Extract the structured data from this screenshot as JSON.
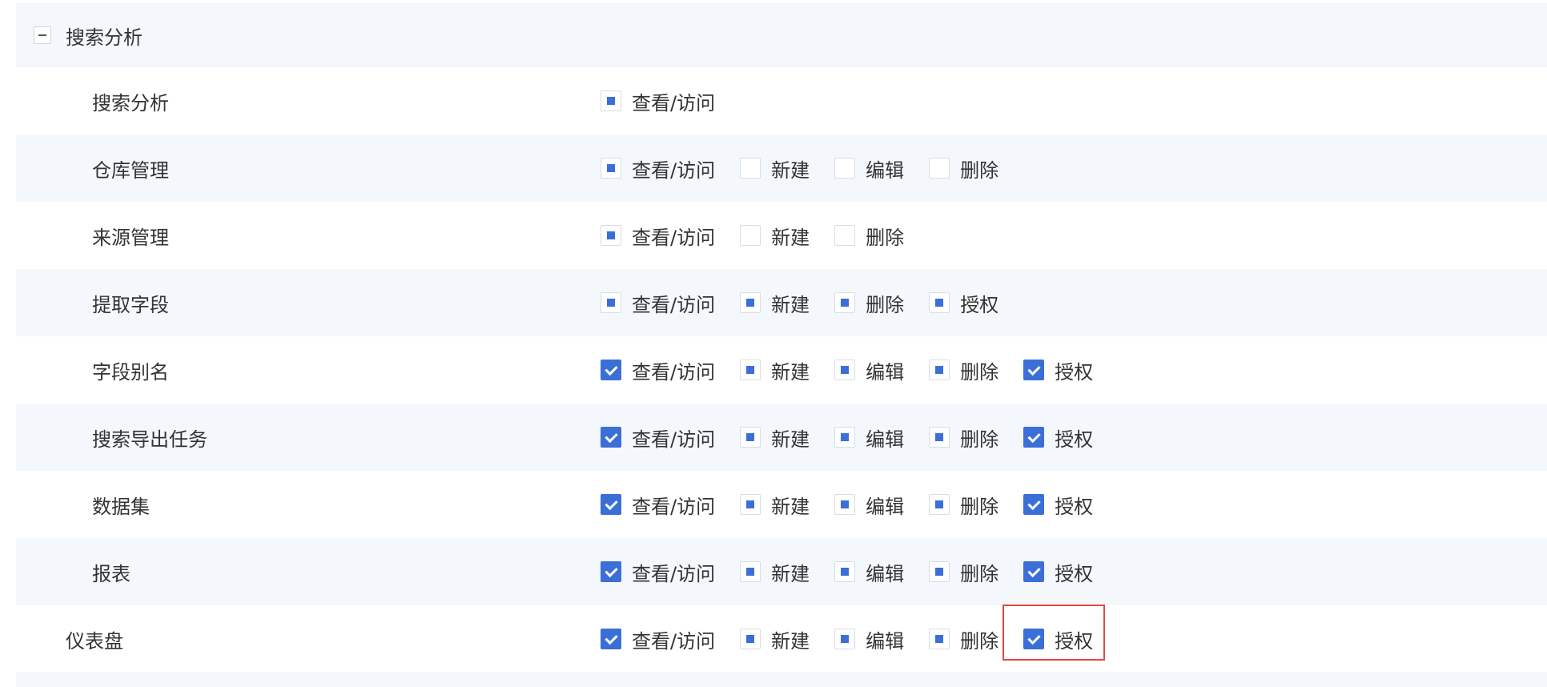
{
  "group": {
    "label": "搜索分析",
    "toggle_icon": "minus-icon"
  },
  "rows": [
    {
      "label": "搜索分析",
      "level": "child",
      "perms": [
        {
          "label": "查看/访问",
          "state": "partial"
        }
      ]
    },
    {
      "label": "仓库管理",
      "level": "child",
      "perms": [
        {
          "label": "查看/访问",
          "state": "partial"
        },
        {
          "label": "新建",
          "state": "unchecked"
        },
        {
          "label": "编辑",
          "state": "unchecked"
        },
        {
          "label": "删除",
          "state": "unchecked"
        }
      ]
    },
    {
      "label": "来源管理",
      "level": "child",
      "perms": [
        {
          "label": "查看/访问",
          "state": "partial"
        },
        {
          "label": "新建",
          "state": "unchecked"
        },
        {
          "label": "删除",
          "state": "unchecked"
        }
      ]
    },
    {
      "label": "提取字段",
      "level": "child",
      "perms": [
        {
          "label": "查看/访问",
          "state": "partial"
        },
        {
          "label": "新建",
          "state": "partial"
        },
        {
          "label": "删除",
          "state": "partial"
        },
        {
          "label": "授权",
          "state": "partial"
        }
      ]
    },
    {
      "label": "字段别名",
      "level": "child",
      "perms": [
        {
          "label": "查看/访问",
          "state": "checked"
        },
        {
          "label": "新建",
          "state": "partial"
        },
        {
          "label": "编辑",
          "state": "partial"
        },
        {
          "label": "删除",
          "state": "partial"
        },
        {
          "label": "授权",
          "state": "checked"
        }
      ]
    },
    {
      "label": "搜索导出任务",
      "level": "child",
      "perms": [
        {
          "label": "查看/访问",
          "state": "checked"
        },
        {
          "label": "新建",
          "state": "partial"
        },
        {
          "label": "编辑",
          "state": "partial"
        },
        {
          "label": "删除",
          "state": "partial"
        },
        {
          "label": "授权",
          "state": "checked"
        }
      ]
    },
    {
      "label": "数据集",
      "level": "child",
      "perms": [
        {
          "label": "查看/访问",
          "state": "checked"
        },
        {
          "label": "新建",
          "state": "partial"
        },
        {
          "label": "编辑",
          "state": "partial"
        },
        {
          "label": "删除",
          "state": "partial"
        },
        {
          "label": "授权",
          "state": "checked"
        }
      ]
    },
    {
      "label": "报表",
      "level": "child",
      "perms": [
        {
          "label": "查看/访问",
          "state": "checked"
        },
        {
          "label": "新建",
          "state": "partial"
        },
        {
          "label": "编辑",
          "state": "partial"
        },
        {
          "label": "删除",
          "state": "partial"
        },
        {
          "label": "授权",
          "state": "checked"
        }
      ]
    },
    {
      "label": "仪表盘",
      "level": "top",
      "perms": [
        {
          "label": "查看/访问",
          "state": "checked"
        },
        {
          "label": "新建",
          "state": "partial"
        },
        {
          "label": "编辑",
          "state": "partial"
        },
        {
          "label": "删除",
          "state": "partial"
        },
        {
          "label": "授权",
          "state": "checked"
        }
      ]
    }
  ],
  "colors": {
    "accent": "#3b6fd8",
    "row_shade": "#f4f7fc",
    "highlight": "#e4483d"
  }
}
